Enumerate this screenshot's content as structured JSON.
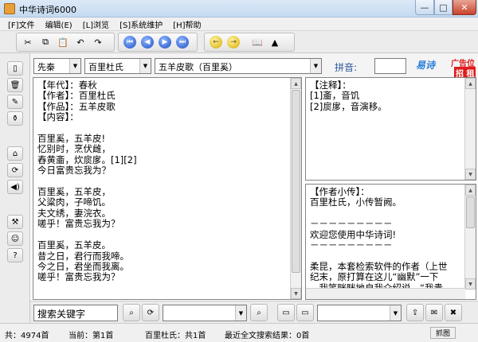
{
  "window": {
    "title": "中华诗词6000"
  },
  "menu": [
    "[F]文件",
    "编辑(E)",
    "[L]浏览",
    "[S]系统维护",
    "[H]帮助"
  ],
  "toolbar": {
    "group1": [
      "✂",
      "⧉",
      "📋",
      "↶",
      "↷"
    ],
    "group2": [
      "⏮",
      "◀",
      "▶",
      "⏭"
    ],
    "group3": [
      "←",
      "→",
      "📖",
      "▲"
    ]
  },
  "filters": {
    "dynasty": "先秦",
    "author": "百里杜氏",
    "poem": "五羊皮歌（百里奚）",
    "pinyin_label": "拼音:"
  },
  "ad": {
    "logo": "易诗",
    "line1": "广告位",
    "line2": "招 租"
  },
  "main_text": "【年代】：春秋\n【作者】：百里杜氏\n【作品】：五羊皮歌\n【内容】：\n\n百里奚，五羊皮!\n忆别时，烹伏雌，\n舂黄齑，炊扊扅。[1][2]\n今日富贵忘我为？\n\n百里奚，五羊皮，\n父粱肉，子啼饥。\n夫文绣，妻浣衣。\n嗟乎！富贵忘我为？\n\n百里奚，五羊皮。\n昔之日，君行而我啼。\n今之日，君坐而我离。\n嗟乎！富贵忘我为？",
  "notes_text": "【注释】：\n[1]齑，音饥\n[2]扊扅，音演移。",
  "bio_text": "【作者小传】：\n百里杜氏，小传暂阙。\n\n－－－－－－－－－\n欢迎您使用中华诗词!\n－－－－－－－－－\n\n柔昆，本套检索软件的作者（上世\n纪末，原打算在这儿“幽默”一下\n，我笑眯眯地自我介绍说，“我贵\n姓方”，结果《中华诗词》的用户",
  "search": {
    "keyword_label": "搜索关键字"
  },
  "status": {
    "total": "共：4974首",
    "current": "当前：第1首",
    "author_count": "百里杜氏：共1首",
    "search_result": "最近全文搜索结果：0首",
    "indicator": "抓图"
  }
}
